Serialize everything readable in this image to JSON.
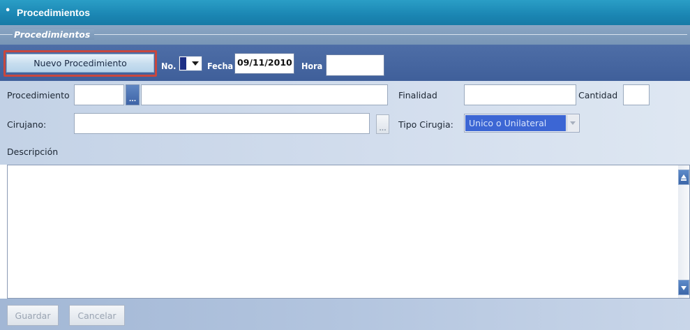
{
  "window": {
    "title": "Procedimientos",
    "section_legend": "Procedimientos"
  },
  "toolbar": {
    "new_button_label": "Nuevo Procedimiento",
    "no_label": "No.",
    "fecha_label": "Fecha",
    "fecha_value": "09/11/2010",
    "hora_label": "Hora",
    "hora_value": ""
  },
  "form": {
    "procedimiento_label": "Procedimiento",
    "procedimiento_code": "",
    "procedimiento_lookup_glyph": "...",
    "procedimiento_desc": "",
    "finalidad_label": "Finalidad",
    "finalidad_value": "",
    "cantidad_label": "Cantidad",
    "cantidad_value": "",
    "cirujano_label": "Cirujano:",
    "cirujano_value": "",
    "cirujano_lookup_glyph": "...",
    "tipo_cirugia_label": "Tipo Cirugia:",
    "tipo_cirugia_value": "Unico o Unilateral",
    "descripcion_label": "Descripción",
    "descripcion_value": ""
  },
  "actions": {
    "guardar_label": "Guardar",
    "cancelar_label": "Cancelar"
  },
  "colors": {
    "title_bar": "#1b86b3",
    "toolbar": "#4e6ea7",
    "highlight_border": "#c8473e",
    "selected_option": "#3c66d4"
  }
}
